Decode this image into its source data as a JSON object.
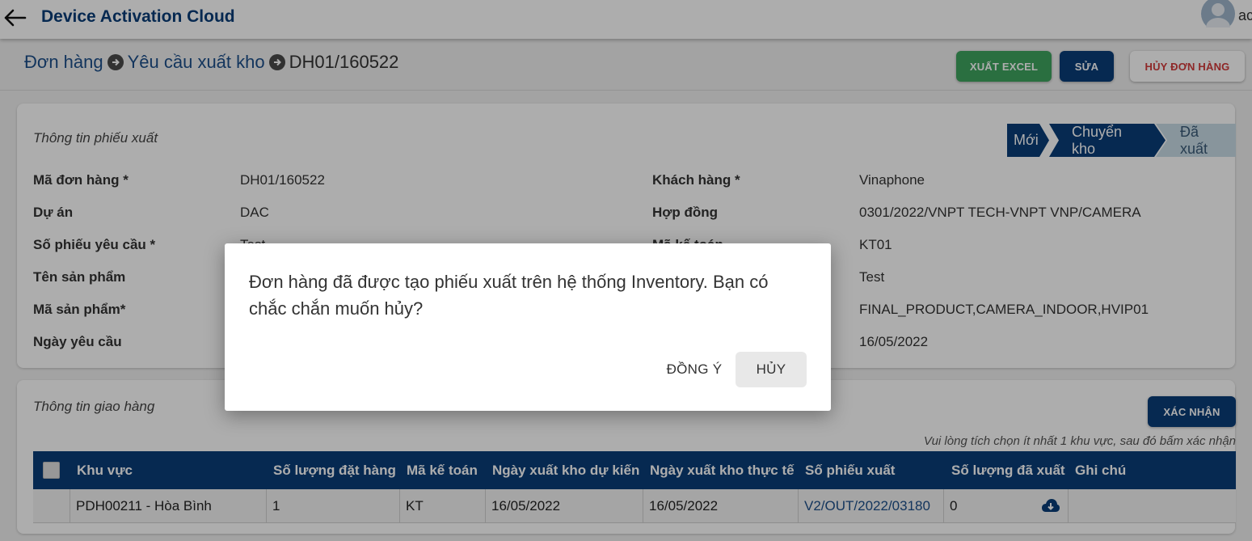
{
  "header": {
    "app_title": "Device Activation Cloud",
    "user_name": "ac"
  },
  "breadcrumb": {
    "items": [
      "Đơn hàng",
      "Yêu cầu xuất kho",
      "DH01/160522"
    ]
  },
  "actions": {
    "export_excel": "XUẤT EXCEL",
    "edit": "SỬA",
    "cancel_order": "HỦY ĐƠN HÀNG"
  },
  "export_info": {
    "title": "Thông tin phiếu xuất",
    "steps": [
      "Mới",
      "Chuyển kho",
      "Đã xuất"
    ],
    "left_fields": [
      {
        "label": "Mã đơn hàng *",
        "value": "DH01/160522"
      },
      {
        "label": "Dự án",
        "value": "DAC"
      },
      {
        "label": "Số phiếu yêu cầu *",
        "value": "Test"
      },
      {
        "label": "Tên sản phẩm",
        "value": ""
      },
      {
        "label": "Mã sản phẩm*",
        "value": ""
      },
      {
        "label": "Ngày yêu cầu",
        "value": ""
      }
    ],
    "right_fields": [
      {
        "label": "Khách hàng *",
        "value": "Vinaphone"
      },
      {
        "label": "Hợp đồng",
        "value": "0301/2022/VNPT TECH-VNPT VNP/CAMERA"
      },
      {
        "label": "Mã kế toán",
        "value": "KT01"
      },
      {
        "label": "",
        "value": "Test"
      },
      {
        "label": "",
        "value": "FINAL_PRODUCT,CAMERA_INDOOR,HVIP01"
      },
      {
        "label": "",
        "value": "16/05/2022"
      }
    ]
  },
  "delivery_info": {
    "title": "Thông tin giao hàng",
    "confirm_button": "XÁC NHẬN",
    "note": "Vui lòng tích chọn ít nhất 1 khu vực, sau đó bấm xác nhận",
    "columns": [
      "Khu vực",
      "Số lượng đặt hàng",
      "Mã kế toán",
      "Ngày xuất kho dự kiến",
      "Ngày xuất kho thực tế",
      "Số phiếu xuất",
      "Số lượng đã xuất",
      "Ghi chú"
    ],
    "rows": [
      [
        "PDH00211 - Hòa Bình",
        "1",
        "KT",
        "16/05/2022",
        "16/05/2022",
        "V2/OUT/2022/03180",
        "0",
        ""
      ]
    ]
  },
  "dialog": {
    "message": "Đơn hàng đã được tạo phiếu xuất trên hệ thống Inventory. Bạn có chắc chắn muốn hủy?",
    "agree": "ĐỒNG Ý",
    "cancel": "HỦY"
  },
  "colors": {
    "primary": "#0a3d78",
    "success": "#3fa45f",
    "danger": "#d23a3a",
    "step_inactive": "#c9dce6"
  }
}
